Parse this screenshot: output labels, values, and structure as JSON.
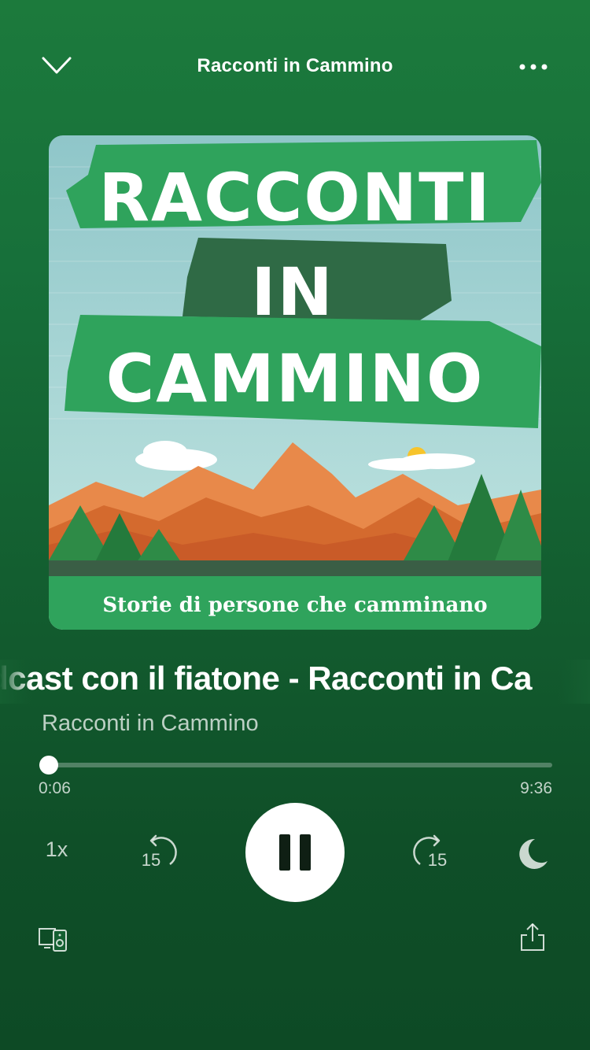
{
  "header": {
    "title": "Racconti in Cammino",
    "collapse_icon": "chevron-down-icon",
    "more_icon": "more-horizontal-icon"
  },
  "artwork": {
    "title_line1": "RACCONTI",
    "title_line2": "IN",
    "title_line3": "CAMMINO",
    "tagline": "Storie di persone che camminano"
  },
  "track": {
    "title": "dcast con il fiatone - Racconti in Ca",
    "artist": "Racconti in Cammino"
  },
  "progress": {
    "elapsed": "0:06",
    "total": "9:36",
    "fraction": 0.0104
  },
  "controls": {
    "speed_label": "1x",
    "skip_back_label": "15",
    "skip_forward_label": "15",
    "play_state": "playing",
    "sleep_icon": "moon-icon"
  },
  "footer": {
    "devices_icon": "connect-devices-icon",
    "share_icon": "share-icon"
  },
  "colors": {
    "background_top": "#1c7a3c",
    "background_bottom": "#0d4a25",
    "accent_white": "#ffffff"
  }
}
